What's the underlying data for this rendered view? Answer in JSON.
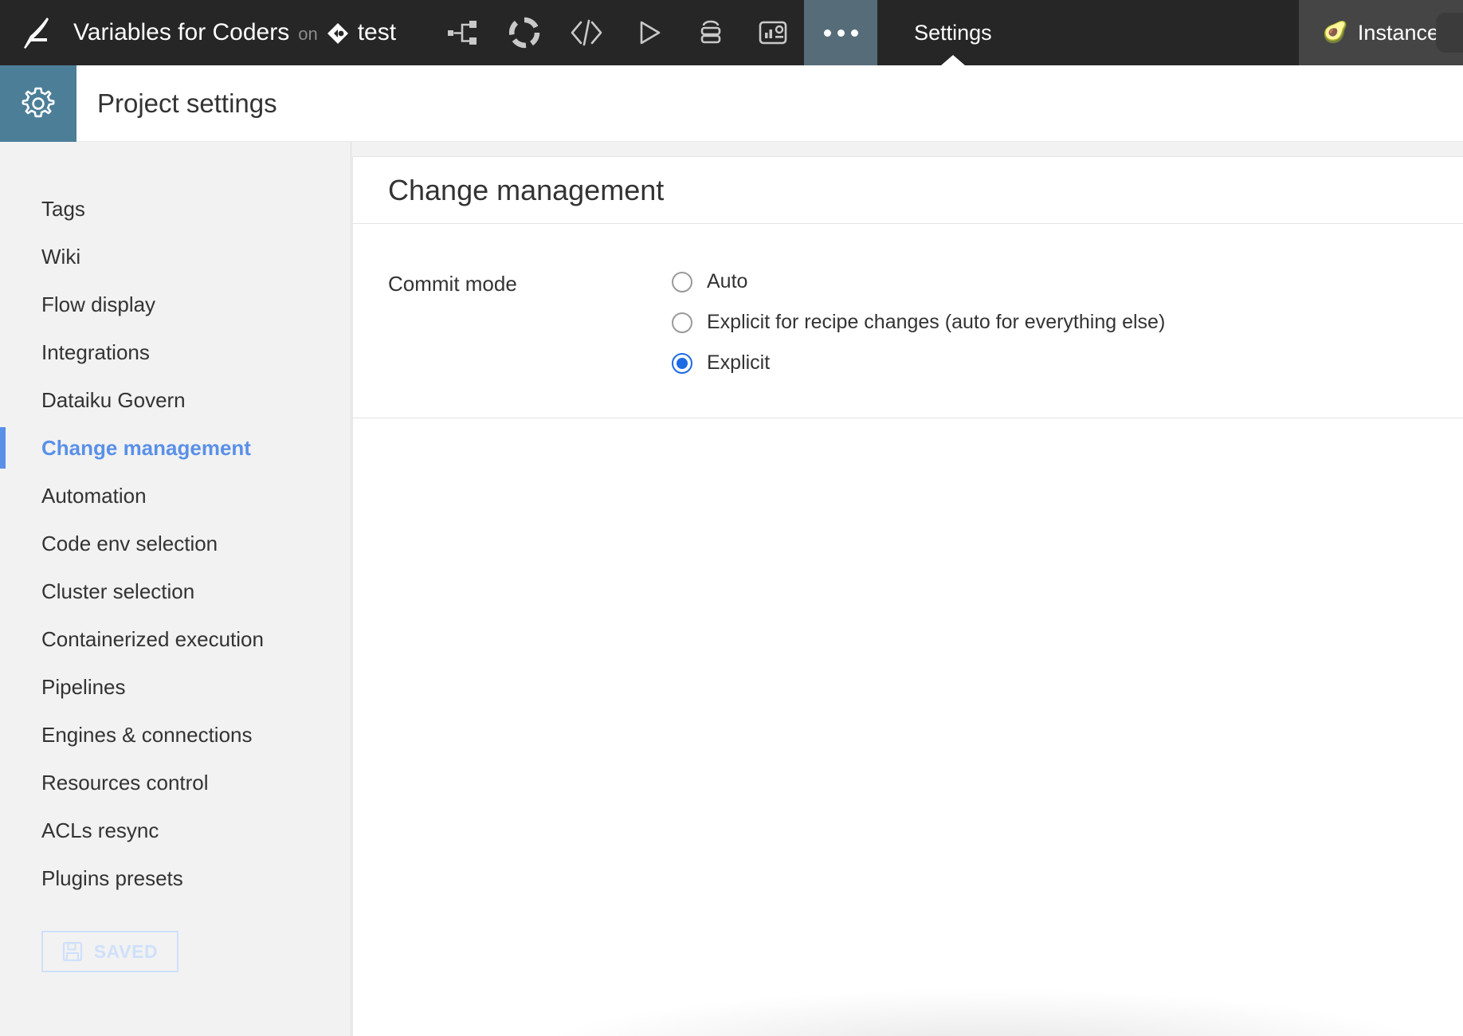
{
  "topbar": {
    "logo_icon": "dataiku-bird-logo",
    "project_name": "Variables for Coders",
    "on_word": "on",
    "branch_icon": "branch-diamond-icon",
    "branch_name": "test",
    "icons": [
      {
        "name": "flow-icon",
        "label": "Flow"
      },
      {
        "name": "lab-donut-icon",
        "label": "Lab"
      },
      {
        "name": "code-icon",
        "label": "Code"
      },
      {
        "name": "run-icon",
        "label": "Run"
      },
      {
        "name": "jobs-stack-icon",
        "label": "Jobs"
      },
      {
        "name": "dashboard-insight-icon",
        "label": "Dashboards"
      }
    ],
    "more_label": "...",
    "active_tab": "Settings",
    "instance_label": "Instance",
    "instance_emoji": "🥑",
    "more_bg_color": "#566d79",
    "bar_bg_color": "#262626"
  },
  "subheader": {
    "gear_icon": "gear-icon",
    "title": "Project settings",
    "gear_bg_color": "#4c7e98"
  },
  "sidebar": {
    "items": [
      {
        "label": "Tags",
        "active": false
      },
      {
        "label": "Wiki",
        "active": false
      },
      {
        "label": "Flow display",
        "active": false
      },
      {
        "label": "Integrations",
        "active": false
      },
      {
        "label": "Dataiku Govern",
        "active": false
      },
      {
        "label": "Change management",
        "active": true
      },
      {
        "label": "Automation",
        "active": false
      },
      {
        "label": "Code env selection",
        "active": false
      },
      {
        "label": "Cluster selection",
        "active": false
      },
      {
        "label": "Containerized execution",
        "active": false
      },
      {
        "label": "Pipelines",
        "active": false
      },
      {
        "label": "Engines & connections",
        "active": false
      },
      {
        "label": "Resources control",
        "active": false
      },
      {
        "label": "ACLs resync",
        "active": false
      },
      {
        "label": "Plugins presets",
        "active": false
      }
    ],
    "active_color": "#5a90e8",
    "save_button": {
      "label": "SAVED",
      "icon": "floppy-disk-save-icon",
      "color": "#cfe0fa"
    }
  },
  "main": {
    "heading": "Change management",
    "commit_mode": {
      "label": "Commit mode",
      "selected": "Explicit",
      "options": [
        {
          "label": "Auto",
          "checked": false
        },
        {
          "label": "Explicit for recipe changes (auto for everything else)",
          "checked": false
        },
        {
          "label": "Explicit",
          "checked": true
        }
      ],
      "accent_color": "#1d6ae5"
    }
  }
}
